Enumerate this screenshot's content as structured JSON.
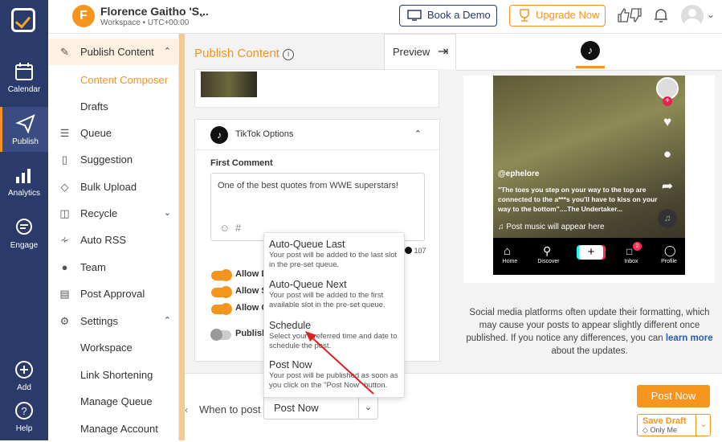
{
  "rail": {
    "items": [
      {
        "label": "Calendar",
        "icon": "calendar-icon"
      },
      {
        "label": "Publish",
        "icon": "publish-icon"
      },
      {
        "label": "Analytics",
        "icon": "analytics-icon"
      },
      {
        "label": "Engage",
        "icon": "engage-icon"
      },
      {
        "label": "Add",
        "icon": "add-icon"
      },
      {
        "label": "Help",
        "icon": "help-icon"
      }
    ]
  },
  "header": {
    "avatar_initial": "F",
    "workspace_name": "Florence Gaitho 'S...",
    "workspace_sub": "Workspace • UTC+00:00",
    "book_demo": "Book a Demo",
    "upgrade": "Upgrade Now"
  },
  "menu": {
    "publish_content": "Publish Content",
    "content_composer": "Content Composer",
    "drafts": "Drafts",
    "queue": "Queue",
    "suggestion": "Suggestion",
    "bulk_upload": "Bulk Upload",
    "recycle": "Recycle",
    "auto_rss": "Auto RSS",
    "team": "Team",
    "post_approval": "Post Approval",
    "settings": "Settings",
    "workspace": "Workspace",
    "link_shortening": "Link Shortening",
    "manage_queue": "Manage Queue",
    "manage_account": "Manage Account"
  },
  "composer": {
    "title": "Publish Content",
    "preview_tab": "Preview",
    "tiktok_options": "TikTok Options",
    "first_comment_label": "First Comment",
    "first_comment_value": "One of the best quotes from WWE superstars!",
    "char_count": "107",
    "toggle1": "Allow D",
    "toggle2": "Allow S",
    "toggle3": "Allow C",
    "toggle4": "Publish"
  },
  "popup": {
    "options": [
      {
        "title": "Auto-Queue Last",
        "desc": "Your post will be added to the last slot in the pre-set queue."
      },
      {
        "title": "Auto-Queue Next",
        "desc": "Your post will be added to the first available slot in the pre-set queue."
      },
      {
        "title": "Schedule",
        "desc": "Select your preferred time and date to schedule the post."
      },
      {
        "title": "Post Now",
        "desc": "Your post will be published as soon as you click on the \"Post Now\" button."
      }
    ]
  },
  "bottom": {
    "when_to_post": "When to post",
    "selected": "Post Now",
    "post_now": "Post Now",
    "save_draft": "Save Draft",
    "only_me": "Only Me"
  },
  "preview": {
    "username": "@ephelore",
    "caption": "\"The toes you step on your way to the top are connected to the a***s you'll have to kiss on your way to the bottom\"....The Undertaker...",
    "music": "Post music will appear here",
    "nav": [
      "Home",
      "Discover",
      "Inbox",
      "Profile"
    ],
    "inbox_badge": "2",
    "note": "Social media platforms often update their formatting, which may cause your posts to appear slightly different once published. If you notice any differences, you can",
    "learn_more": "learn more",
    "note_end": "about the updates."
  },
  "colors": {
    "accent": "#f7941d",
    "rail": "#2a3a6b"
  }
}
